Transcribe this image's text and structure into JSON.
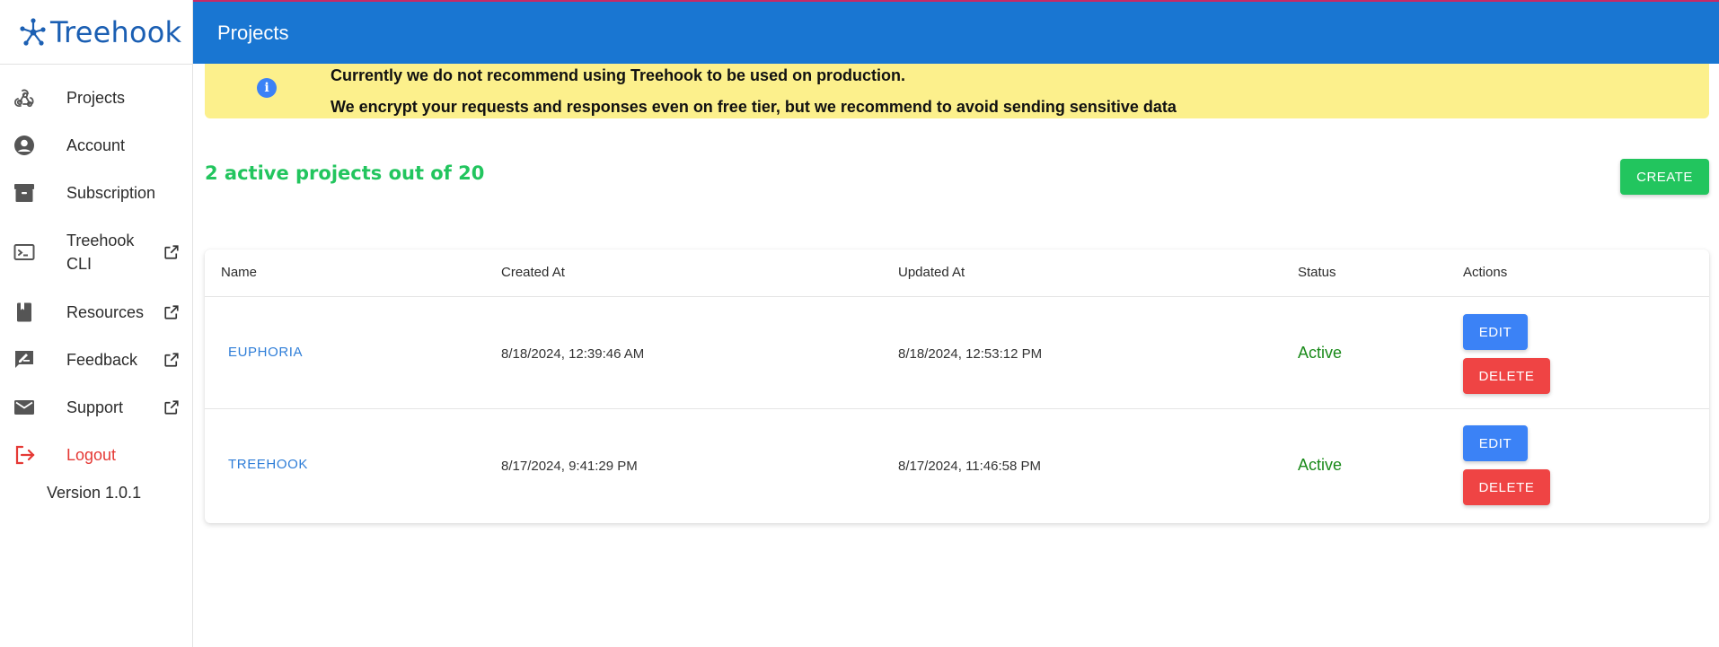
{
  "brand": {
    "name": "Treehook",
    "logo_icon": "treehook-logo-icon"
  },
  "header": {
    "title": "Projects"
  },
  "sidebar": {
    "items": [
      {
        "label": "Projects",
        "icon": "webhook-icon",
        "external": false
      },
      {
        "label": "Account",
        "icon": "account-circle-icon",
        "external": false
      },
      {
        "label": "Subscription",
        "icon": "archive-box-icon",
        "external": false
      },
      {
        "label": "Treehook CLI",
        "icon": "terminal-icon",
        "external": true
      },
      {
        "label": "Resources",
        "icon": "book-icon",
        "external": true
      },
      {
        "label": "Feedback",
        "icon": "feedback-pen-icon",
        "external": true
      },
      {
        "label": "Support",
        "icon": "mail-icon",
        "external": true
      }
    ],
    "logout_label": "Logout",
    "version": "Version 1.0.1"
  },
  "alert": {
    "line1": "Currently we do not recommend using Treehook to be used on production.",
    "line2": "We encrypt your requests and responses even on free tier, but we recommend to avoid sending sensitive data",
    "icon": "info-icon"
  },
  "summary": {
    "text": "2 active projects out of 20"
  },
  "toolbar": {
    "create_label": "CREATE"
  },
  "table": {
    "headers": {
      "name": "Name",
      "created": "Created At",
      "updated": "Updated At",
      "status": "Status",
      "actions": "Actions"
    },
    "rows": [
      {
        "name": "EUPHORIA",
        "created": "8/18/2024, 12:39:46 AM",
        "updated": "8/18/2024, 12:53:12 PM",
        "status": "Active"
      },
      {
        "name": "TREEHOOK",
        "created": "8/17/2024, 9:41:29 PM",
        "updated": "8/17/2024, 11:46:58 PM",
        "status": "Active"
      }
    ],
    "edit_label": "EDIT",
    "delete_label": "DELETE"
  },
  "colors": {
    "header": "#1976d2",
    "alert_bg": "#fcf08c",
    "success": "#22c55e",
    "primary": "#3b82f6",
    "danger": "#ef4444",
    "brand": "#1b5fb3"
  }
}
